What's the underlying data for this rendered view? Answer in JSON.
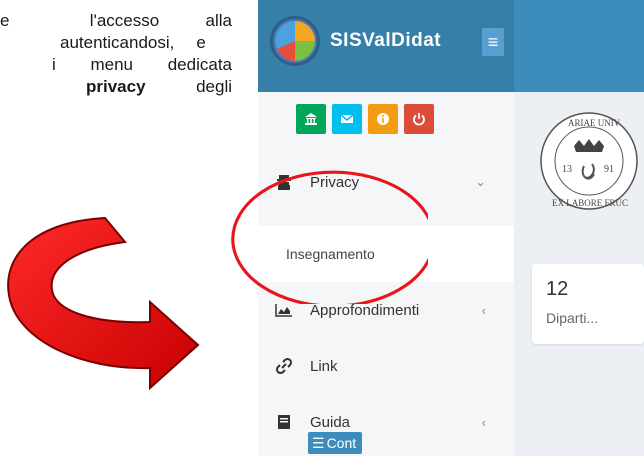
{
  "document": {
    "lines": [
      [
        "e",
        "l'accesso",
        "alla"
      ],
      [
        "autenticandosi,",
        "e"
      ],
      [
        "i",
        "menu",
        "dedicata"
      ],
      [
        "privacy",
        "degli"
      ]
    ]
  },
  "app": {
    "brand": "SISValDidat",
    "hamburger_icon": "≡",
    "sidebar": {
      "quick_buttons": [
        {
          "name": "university-icon",
          "glyph": "🏛"
        },
        {
          "name": "mail-icon",
          "glyph": "✉"
        },
        {
          "name": "info-icon",
          "glyph": "ℹ"
        },
        {
          "name": "power-icon",
          "glyph": "⏻"
        }
      ],
      "items": [
        {
          "label": "Privacy",
          "icon": "privacy-icon",
          "chevron": "⌄"
        },
        {
          "label": "Insegnamento"
        },
        {
          "label": "Approfondimenti",
          "icon": "chart-icon",
          "chevron": "‹"
        },
        {
          "label": "Link",
          "icon": "link-icon"
        },
        {
          "label": "Guida",
          "icon": "book-icon",
          "chevron": "‹"
        }
      ]
    },
    "stat_card": {
      "value": "12",
      "label": "Diparti..."
    },
    "cont_button": {
      "label": "Cont",
      "icon": "list-icon"
    },
    "seal": {
      "text_top": "ARIAE UNIV",
      "text_bottom": "EX LABORE FRUC",
      "year_left": "13",
      "year_right": "91"
    }
  },
  "colors": {
    "topbar": "#3c8dbc",
    "logo_bg": "#367fa9",
    "highlight": "#e8161c"
  }
}
